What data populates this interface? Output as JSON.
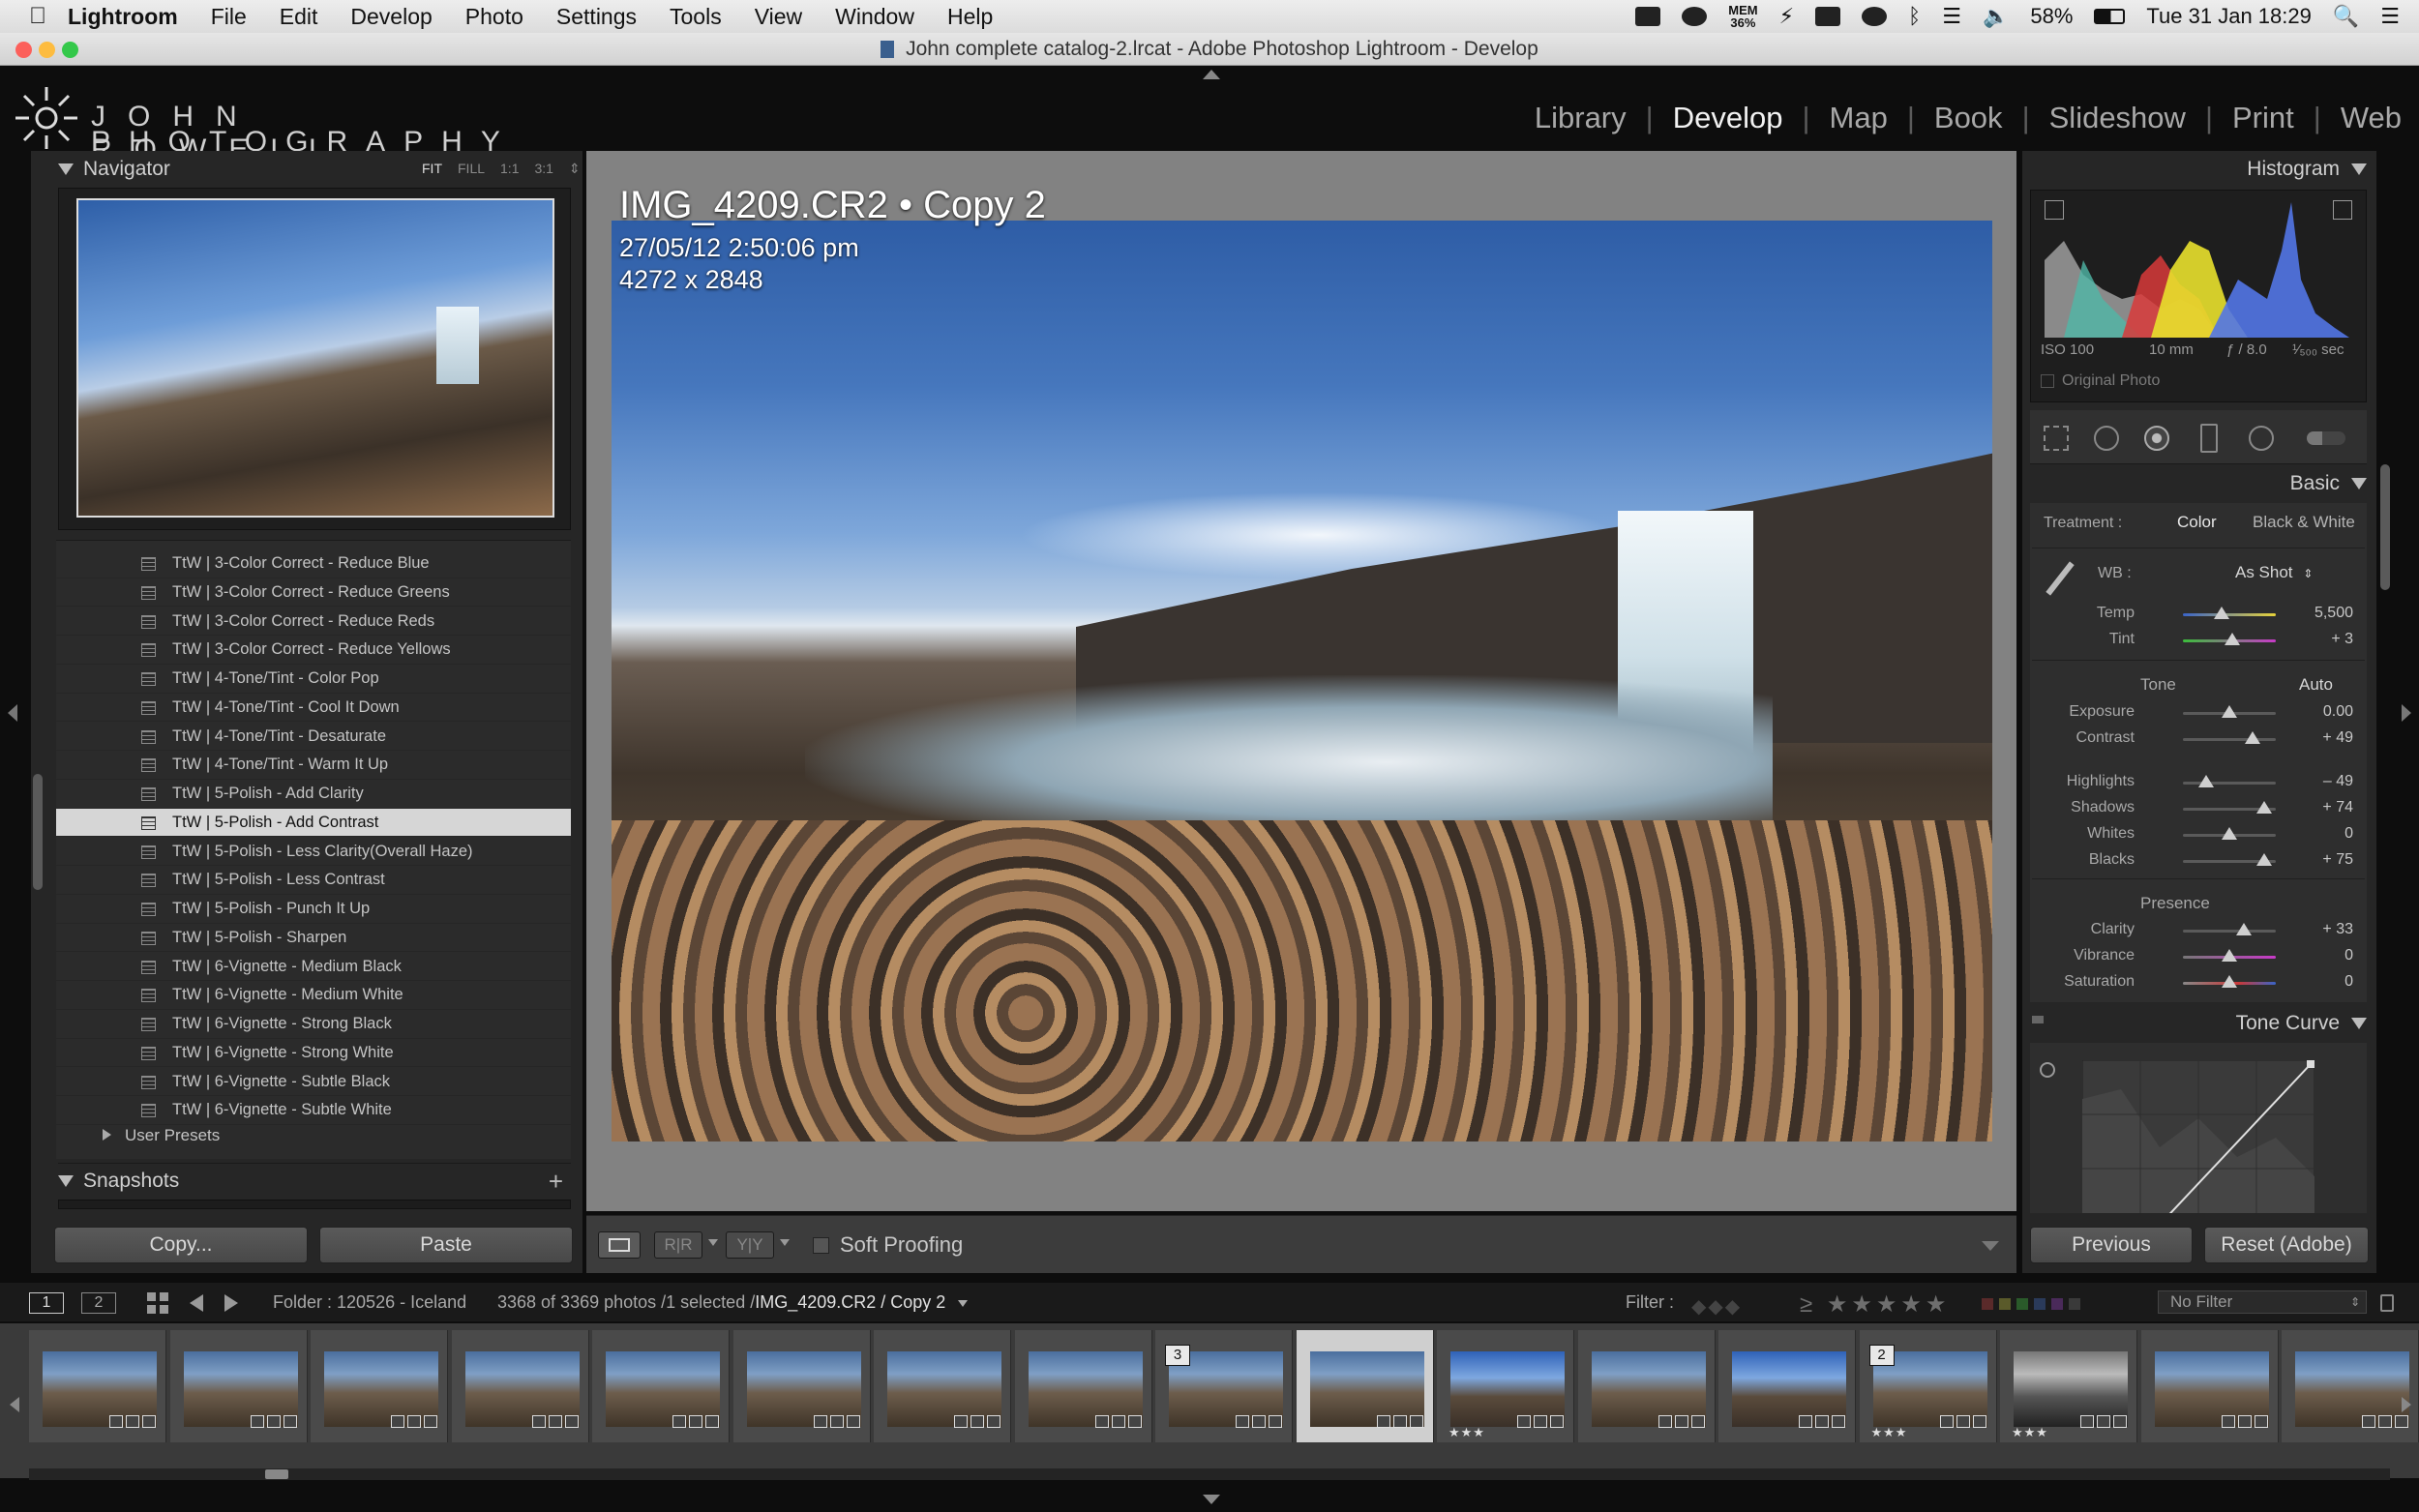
{
  "menubar": {
    "app": "Lightroom",
    "items": [
      "File",
      "Edit",
      "Develop",
      "Photo",
      "Settings",
      "Tools",
      "View",
      "Window",
      "Help"
    ],
    "status": {
      "mem_label": "MEM",
      "mem_value": "36%",
      "battery": "58%",
      "datetime": "Tue 31 Jan  18:29"
    }
  },
  "window": {
    "title": "John complete catalog-2.lrcat - Adobe Photoshop Lightroom - Develop"
  },
  "identity_plate": {
    "line1": "JOHN ROWELL",
    "line2": "PHOTOGRAPHY"
  },
  "modules": [
    {
      "label": "Library",
      "active": false
    },
    {
      "label": "Develop",
      "active": true
    },
    {
      "label": "Map",
      "active": false
    },
    {
      "label": "Book",
      "active": false
    },
    {
      "label": "Slideshow",
      "active": false
    },
    {
      "label": "Print",
      "active": false
    },
    {
      "label": "Web",
      "active": false
    }
  ],
  "navigator": {
    "title": "Navigator",
    "zoom_options": [
      "FIT",
      "FILL",
      "1:1",
      "3:1"
    ]
  },
  "presets": {
    "items": [
      "TtW | 3-Color Correct - Reduce Blue",
      "TtW | 3-Color Correct - Reduce Greens",
      "TtW | 3-Color Correct - Reduce Reds",
      "TtW | 3-Color Correct - Reduce Yellows",
      "TtW | 4-Tone/Tint - Color Pop",
      "TtW | 4-Tone/Tint - Cool It Down",
      "TtW | 4-Tone/Tint - Desaturate",
      "TtW | 4-Tone/Tint - Warm It Up",
      "TtW | 5-Polish - Add Clarity",
      "TtW | 5-Polish - Add Contrast",
      "TtW | 5-Polish - Less Clarity(Overall Haze)",
      "TtW | 5-Polish - Less Contrast",
      "TtW | 5-Polish - Punch It Up",
      "TtW | 5-Polish - Sharpen",
      "TtW | 6-Vignette - Medium Black",
      "TtW | 6-Vignette - Medium White",
      "TtW | 6-Vignette - Strong Black",
      "TtW | 6-Vignette - Strong White",
      "TtW | 6-Vignette - Subtle Black",
      "TtW | 6-Vignette - Subtle White"
    ],
    "selected_index": 9,
    "user_presets": "User Presets"
  },
  "snapshots": {
    "title": "Snapshots",
    "add": "+"
  },
  "left_buttons": {
    "copy": "Copy...",
    "paste": "Paste"
  },
  "photo": {
    "name": "IMG_4209.CR2  •  Copy 2",
    "datetime": "27/05/12 2:50:06 pm",
    "dimensions": "4272 x 2848"
  },
  "toolbar": {
    "soft_proofing": "Soft Proofing"
  },
  "histogram": {
    "title": "Histogram",
    "iso": "ISO 100",
    "focal": "10 mm",
    "aperture": "ƒ / 8.0",
    "shutter": "¹⁄₅₀₀ sec",
    "original_photo": "Original Photo"
  },
  "basic": {
    "title": "Basic",
    "treatment_label": "Treatment :",
    "treatment_color": "Color",
    "treatment_bw": "Black & White",
    "wb_label": "WB :",
    "wb_value": "As Shot",
    "tone_label": "Tone",
    "auto": "Auto",
    "presence_label": "Presence",
    "sliders": [
      {
        "label": "Temp",
        "value": "5,500",
        "pos": 0.42,
        "group": "wb"
      },
      {
        "label": "Tint",
        "value": "+ 3",
        "pos": 0.53,
        "group": "wb"
      },
      {
        "label": "Exposure",
        "value": "0.00",
        "pos": 0.5,
        "group": "tone"
      },
      {
        "label": "Contrast",
        "value": "+ 49",
        "pos": 0.75,
        "group": "tone"
      },
      {
        "label": "Highlights",
        "value": "– 49",
        "pos": 0.25,
        "group": "tone2"
      },
      {
        "label": "Shadows",
        "value": "+ 74",
        "pos": 0.87,
        "group": "tone2"
      },
      {
        "label": "Whites",
        "value": "0",
        "pos": 0.5,
        "group": "tone2"
      },
      {
        "label": "Blacks",
        "value": "+ 75",
        "pos": 0.87,
        "group": "tone2"
      },
      {
        "label": "Clarity",
        "value": "+ 33",
        "pos": 0.66,
        "group": "presence"
      },
      {
        "label": "Vibrance",
        "value": "0",
        "pos": 0.5,
        "group": "presence"
      },
      {
        "label": "Saturation",
        "value": "0",
        "pos": 0.5,
        "group": "presence"
      }
    ]
  },
  "tone_curve": {
    "title": "Tone Curve"
  },
  "right_buttons": {
    "previous": "Previous",
    "reset": "Reset (Adobe)"
  },
  "filmstrip_bar": {
    "page1": "1",
    "page2": "2",
    "folder": "Folder : 120526 - Iceland",
    "count": "3368 of 3369 photos /1 selected /",
    "selected_file": "IMG_4209.CR2 / Copy 2",
    "filter_label": "Filter :",
    "filter_value": "No Filter"
  },
  "filmstrip": [
    {
      "num": "",
      "stars": "",
      "sel": false
    },
    {
      "num": "",
      "stars": "",
      "sel": false
    },
    {
      "num": "",
      "stars": "",
      "sel": false
    },
    {
      "num": "",
      "stars": "",
      "sel": false
    },
    {
      "num": "",
      "stars": "",
      "sel": false
    },
    {
      "num": "",
      "stars": "",
      "sel": false
    },
    {
      "num": "",
      "stars": "",
      "sel": false
    },
    {
      "num": "",
      "stars": "",
      "sel": false
    },
    {
      "num": "3",
      "stars": "",
      "sel": false
    },
    {
      "num": "",
      "stars": "",
      "sel": true
    },
    {
      "num": "",
      "stars": "★★★",
      "sel": false
    },
    {
      "num": "",
      "stars": "",
      "sel": false
    },
    {
      "num": "",
      "stars": "",
      "sel": false
    },
    {
      "num": "2",
      "stars": "★★★",
      "sel": false
    },
    {
      "num": "",
      "stars": "★★★",
      "sel": false
    },
    {
      "num": "",
      "stars": "",
      "sel": false
    },
    {
      "num": "",
      "stars": "",
      "sel": false
    }
  ]
}
